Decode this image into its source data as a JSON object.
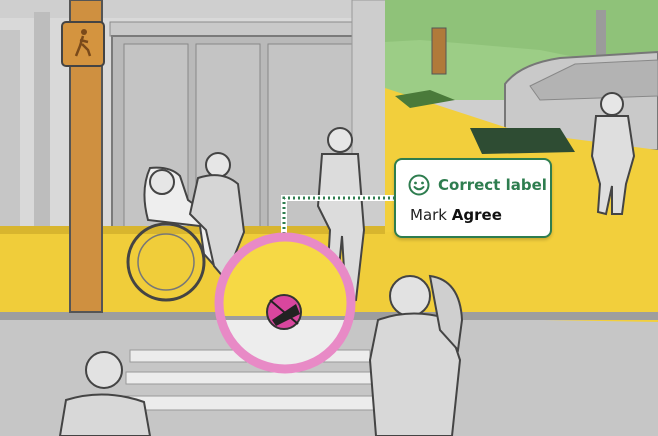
{
  "tooltip": {
    "title": "Correct label",
    "instruction_prefix": "Mark",
    "instruction_action": "Agree",
    "icon": "smile-icon",
    "accent_color": "#2e7d4f"
  },
  "marker": {
    "icon": "curb-ramp-missing-icon",
    "ring_color": "#e88ac6"
  },
  "sign": {
    "icon": "pedestrian-walk-icon"
  }
}
